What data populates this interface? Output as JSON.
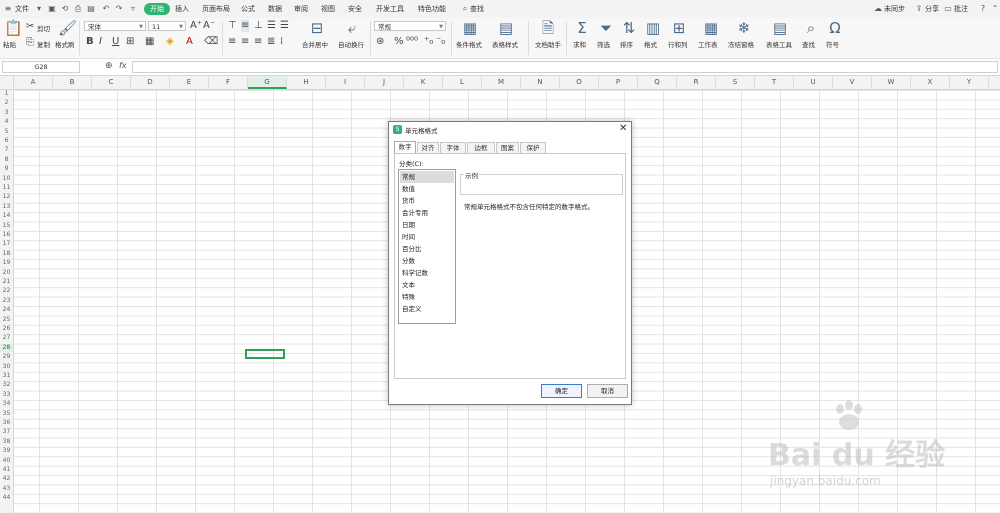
{
  "menubar": {
    "file_label": "文件",
    "tabs": [
      "开始",
      "插入",
      "页面布局",
      "公式",
      "数据",
      "审阅",
      "视图",
      "安全",
      "开发工具",
      "特色功能"
    ],
    "active_tab": "开始",
    "search_label": "查找",
    "sync_label": "未同步",
    "share_label": "分享",
    "comment_label": "批注"
  },
  "ribbon": {
    "paste": "粘贴",
    "cut": "剪切",
    "copy": "复制",
    "format_painter": "格式刷",
    "font_name": "宋体",
    "font_size": "11",
    "merge_center": "合并居中",
    "wrap_text": "自动换行",
    "number_format": "常规",
    "conditional_format": "条件格式",
    "table_style": "表格样式",
    "doc_helper": "文档助手",
    "sum": "求和",
    "filter": "筛选",
    "sort": "排序",
    "format": "格式",
    "row_col": "行和列",
    "worksheet": "工作表",
    "freeze": "冻结窗格",
    "table_tools": "表格工具",
    "find": "查找",
    "symbol": "符号"
  },
  "formula": {
    "name_box": "G28",
    "fx": "fx"
  },
  "grid": {
    "columns": [
      "A",
      "B",
      "C",
      "D",
      "E",
      "F",
      "G",
      "H",
      "I",
      "J",
      "K",
      "L",
      "M",
      "N",
      "O",
      "P",
      "Q",
      "R",
      "S",
      "T",
      "U",
      "V",
      "W",
      "X",
      "Y"
    ],
    "rows": [
      "1",
      "2",
      "3",
      "4",
      "5",
      "6",
      "7",
      "8",
      "9",
      "10",
      "11",
      "12",
      "13",
      "14",
      "15",
      "16",
      "17",
      "18",
      "19",
      "20",
      "21",
      "22",
      "23",
      "24",
      "25",
      "26",
      "27",
      "28",
      "29",
      "30",
      "31",
      "32",
      "33",
      "34",
      "35",
      "36",
      "37",
      "38",
      "39",
      "40",
      "41",
      "42",
      "43",
      "44"
    ],
    "selected_column": "G",
    "selected_row": "28"
  },
  "dialog": {
    "title": "单元格格式",
    "tabs": [
      "数字",
      "对齐",
      "字体",
      "边框",
      "图案",
      "保护"
    ],
    "active_tab": "数字",
    "category_label": "分类(C):",
    "categories": [
      "常规",
      "数值",
      "货币",
      "会计专用",
      "日期",
      "时间",
      "百分比",
      "分数",
      "科学记数",
      "文本",
      "特殊",
      "自定义"
    ],
    "selected_category": "常规",
    "sample_label": "示例",
    "description": "常规单元格格式不包含任何特定的数字格式。",
    "ok_label": "确定",
    "cancel_label": "取消"
  },
  "watermark": {
    "main": "Bai du 经验",
    "sub": "jingyan.baidu.com"
  },
  "colors": {
    "accent_green": "#2fb573",
    "selection_green": "#2fa056"
  }
}
